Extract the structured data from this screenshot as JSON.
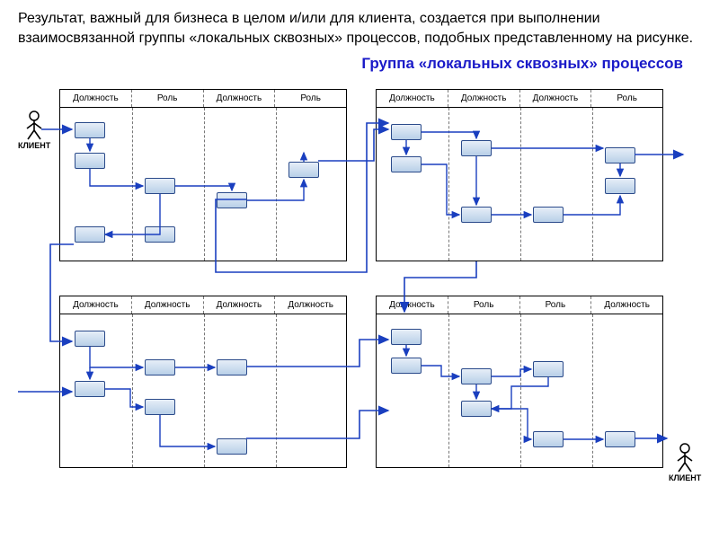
{
  "intro": "Результат, важный для бизнеса в целом и/или для клиента, создается при выполнении взаимосвязанной группы «локальных сквозных» процессов, подобных представленному на рисунке.",
  "title": "Группа «локальных сквозных» процессов",
  "client_label": "КЛИЕНТ",
  "panels": {
    "tl": {
      "lanes": [
        "Должность",
        "Роль",
        "Должность",
        "Роль"
      ]
    },
    "tr": {
      "lanes": [
        "Должность",
        "Должность",
        "Должность",
        "Роль"
      ]
    },
    "bl": {
      "lanes": [
        "Должность",
        "Должность",
        "Должность",
        "Должность"
      ]
    },
    "br": {
      "lanes": [
        "Должность",
        "Роль",
        "Роль",
        "Должность"
      ]
    }
  }
}
